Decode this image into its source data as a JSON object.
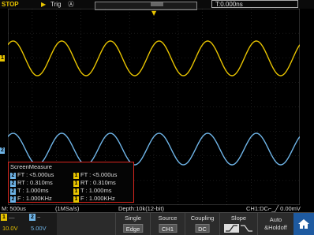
{
  "top": {
    "run_status": "STOP",
    "trigger_label": "Trig",
    "trigger_mode_icon": "Ⓐ",
    "time_offset": "T:0.000ns"
  },
  "colors": {
    "ch1": "#e8c400",
    "ch2": "#6fb5e8",
    "measure_border": "#d8261e",
    "home": "#1e5aa0"
  },
  "markers": {
    "ch1": "1",
    "ch2": "2"
  },
  "measure": {
    "title": "ScreenMeasure",
    "rows": [
      {
        "left": {
          "ch": "2",
          "text": "FT : <5.000us"
        },
        "right": {
          "ch": "1",
          "text": "FT : <5.000us"
        }
      },
      {
        "left": {
          "ch": "2",
          "text": "RT : 0.310ms"
        },
        "right": {
          "ch": "1",
          "text": "RT : 0.310ms"
        }
      },
      {
        "left": {
          "ch": "2",
          "text": "T : 1.000ms"
        },
        "right": {
          "ch": "1",
          "text": "T : 1.000ms"
        }
      },
      {
        "left": {
          "ch": "2",
          "text": "F : 1.000KHz"
        },
        "right": {
          "ch": "1",
          "text": "F : 1.000KHz"
        }
      }
    ]
  },
  "status": {
    "timebase": "M: 500us",
    "sample_rate": "(1MSa/s)",
    "depth": "Depth:10k(12-bit)",
    "trigger_info": "CH1:DC⌐_╱ 0.00mV"
  },
  "channels": [
    {
      "num": "1",
      "coupling": "—",
      "volts": "10.0V"
    },
    {
      "num": "2",
      "coupling": "~",
      "volts": "5.00V"
    }
  ],
  "menu": {
    "type": {
      "label": "Single",
      "value": "Edge"
    },
    "source": {
      "label": "Source",
      "value": "CH1"
    },
    "coupling": {
      "label": "Coupling",
      "value": "DC"
    },
    "slope": {
      "label": "Slope"
    },
    "holdoff": {
      "line1": "Auto",
      "line2": "&Holdoff"
    }
  }
}
